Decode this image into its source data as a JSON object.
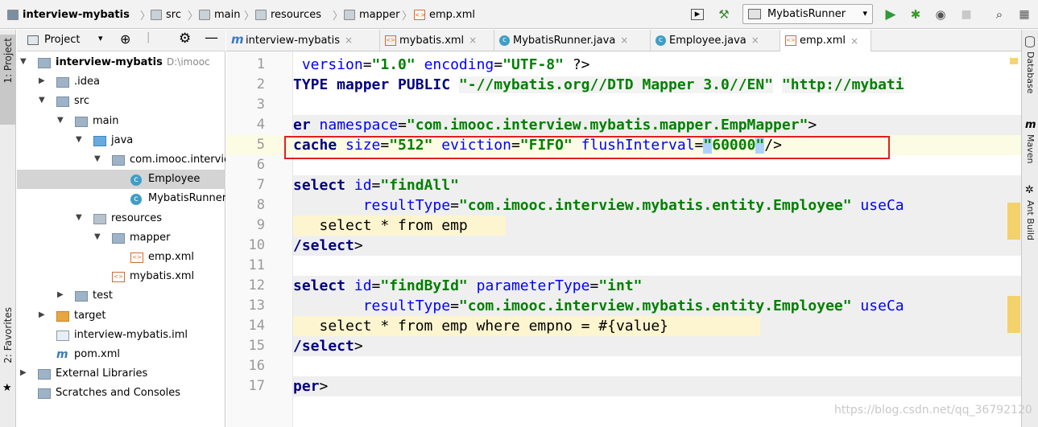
{
  "breadcrumbs": [
    "interview-mybatis",
    "src",
    "main",
    "resources",
    "mapper",
    "emp.xml"
  ],
  "run_config": "MybatisRunner",
  "left_strip": {
    "project": "1: Project",
    "favorites": "2: Favorites"
  },
  "right_strip": {
    "database": "Database",
    "maven": "Maven",
    "ant": "Ant Build"
  },
  "project_panel": {
    "title": "Project"
  },
  "tree": [
    {
      "label": "interview-mybatis",
      "path": "D:\\imooc",
      "icon": "module-folder-icon",
      "open": true,
      "depth": 0
    },
    {
      "label": ".idea",
      "icon": "folder-icon",
      "open": false,
      "depth": 1
    },
    {
      "label": "src",
      "icon": "folder-icon",
      "open": true,
      "depth": 1
    },
    {
      "label": "main",
      "icon": "folder-icon",
      "open": true,
      "depth": 2
    },
    {
      "label": "java",
      "icon": "source-folder-icon",
      "open": true,
      "depth": 3
    },
    {
      "label": "com.imooc.interview.mybatis",
      "icon": "package-icon",
      "open": true,
      "depth": 4
    },
    {
      "label": "Employee",
      "icon": "class-icon",
      "depth": 5,
      "selected": true
    },
    {
      "label": "MybatisRunner",
      "icon": "runnable-class-icon",
      "depth": 5
    },
    {
      "label": "resources",
      "icon": "resources-folder-icon",
      "open": true,
      "depth": 3
    },
    {
      "label": "mapper",
      "icon": "folder-icon",
      "open": true,
      "depth": 4
    },
    {
      "label": "emp.xml",
      "icon": "xml-file-icon",
      "depth": 5
    },
    {
      "label": "mybatis.xml",
      "icon": "xml-file-icon",
      "depth": 4
    },
    {
      "label": "test",
      "icon": "folder-icon",
      "open": false,
      "depth": 2
    },
    {
      "label": "target",
      "icon": "excluded-folder-icon",
      "open": false,
      "depth": 1
    },
    {
      "label": "interview-mybatis.iml",
      "icon": "iml-file-icon",
      "depth": 1
    },
    {
      "label": "pom.xml",
      "icon": "maven-icon",
      "depth": 1
    },
    {
      "label": "External Libraries",
      "icon": "libraries-icon",
      "open": false,
      "depth": 0
    },
    {
      "label": "Scratches and Consoles",
      "icon": "scratches-icon",
      "depth": 0
    }
  ],
  "tabs": [
    {
      "label": "interview-mybatis",
      "icon": "maven-icon"
    },
    {
      "label": "mybatis.xml",
      "icon": "xml-file-icon"
    },
    {
      "label": "MybatisRunner.java",
      "icon": "runnable-class-icon"
    },
    {
      "label": "Employee.java",
      "icon": "class-icon"
    },
    {
      "label": "emp.xml",
      "icon": "xml-file-icon",
      "active": true
    }
  ],
  "line_numbers": [
    "1",
    "2",
    "3",
    "4",
    "5",
    "6",
    "7",
    "8",
    "9",
    "10",
    "11",
    "12",
    "13",
    "14",
    "15",
    "16",
    "17"
  ],
  "code": {
    "l1": [
      " version",
      "=",
      "\"1.0\"",
      " encoding",
      "=",
      "\"UTF-8\"",
      " ?>"
    ],
    "l2": [
      "TYPE mapper PUBLIC ",
      "\"-//mybatis.org//DTD Mapper 3.0//EN\"",
      " ",
      "\"http://mybati"
    ],
    "l4": [
      "er",
      " namespace",
      "=",
      "\"com.imooc.interview.mybatis.mapper.EmpMapper\"",
      ">"
    ],
    "l5": [
      "cache",
      " size",
      "=",
      "\"512\"",
      " eviction",
      "=",
      "\"FIFO\"",
      " flushInterval",
      "=",
      "\"",
      "60000",
      "\"",
      "/>"
    ],
    "l7": [
      "select",
      " id",
      "=",
      "\"findAll\""
    ],
    "l8": [
      "        resultType",
      "=",
      "\"com.imooc.interview.mybatis.entity.Employee\"",
      " useCa"
    ],
    "l9": [
      "   select * from emp"
    ],
    "l10": [
      "/select",
      ">"
    ],
    "l12": [
      "select",
      " id",
      "=",
      "\"findById\"",
      " parameterType",
      "=",
      "\"int\""
    ],
    "l13": [
      "        resultType",
      "=",
      "\"com.imooc.interview.mybatis.entity.Employee\"",
      " useCa"
    ],
    "l14": [
      "   select * from emp where empno = #{value}"
    ],
    "l15": [
      "/select",
      ">"
    ],
    "l17": [
      "per",
      ">"
    ]
  },
  "watermark": "https://blog.csdn.net/qq_36792120"
}
